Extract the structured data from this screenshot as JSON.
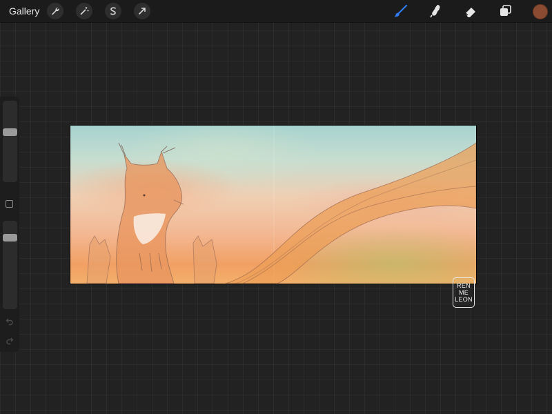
{
  "topbar": {
    "gallery_label": "Gallery",
    "left_tools": [
      {
        "name": "wrench-icon"
      },
      {
        "name": "magic-wand-icon"
      },
      {
        "name": "selection-s-icon"
      },
      {
        "name": "transform-arrow-icon"
      }
    ],
    "right_tools": [
      {
        "name": "brush-icon",
        "active": true
      },
      {
        "name": "smudge-icon"
      },
      {
        "name": "eraser-icon"
      },
      {
        "name": "layers-icon"
      }
    ],
    "current_color": "#8a4b32",
    "accent_color": "#2f7cf6"
  },
  "sidebar": {
    "brush_size_level": 0.25,
    "opacity_level": 0.15
  },
  "watermark": {
    "line1": "REN",
    "line2": "ME",
    "line3": "LEON"
  }
}
